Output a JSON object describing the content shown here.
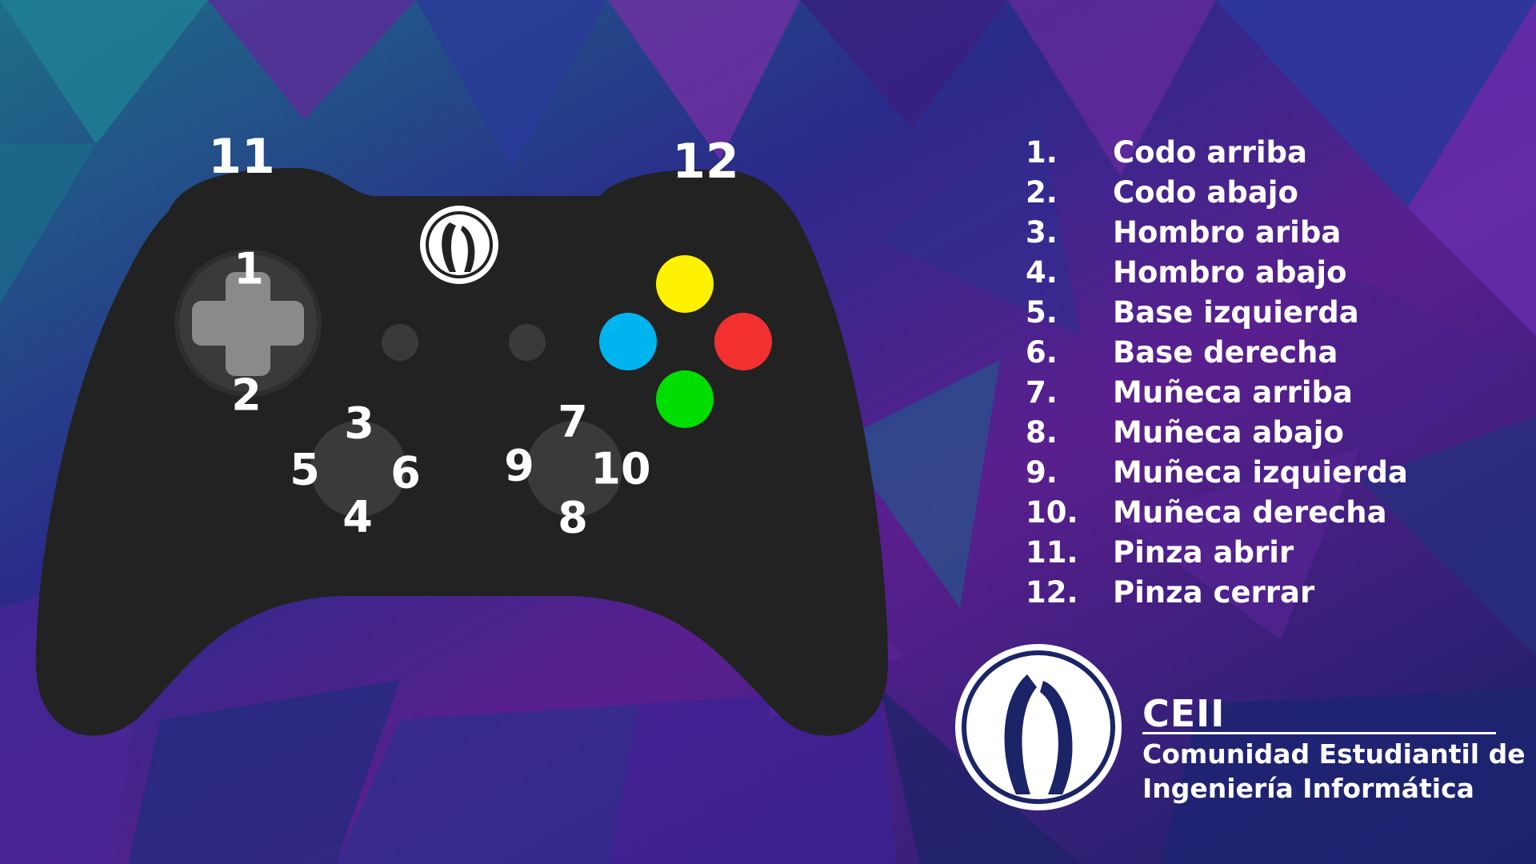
{
  "colors": {
    "controller_body": "#222222",
    "btn_top": "#fff200",
    "btn_left": "#00b4f0",
    "btn_right": "#f23030",
    "btn_bottom": "#00dd00"
  },
  "labels": {
    "n1": "1",
    "n2": "2",
    "n3": "3",
    "n4": "4",
    "n5": "5",
    "n6": "6",
    "n7": "7",
    "n8": "8",
    "n9": "9",
    "n10": "10",
    "n11": "11",
    "n12": "12"
  },
  "legend": [
    {
      "num": "1.",
      "label": "Codo arriba"
    },
    {
      "num": "2.",
      "label": "Codo abajo"
    },
    {
      "num": "3.",
      "label": "Hombro ariba"
    },
    {
      "num": "4.",
      "label": "Hombro abajo"
    },
    {
      "num": "5.",
      "label": "Base izquierda"
    },
    {
      "num": "6.",
      "label": "Base derecha"
    },
    {
      "num": "7.",
      "label": "Muñeca arriba"
    },
    {
      "num": "8.",
      "label": "Muñeca abajo"
    },
    {
      "num": "9.",
      "label": "Muñeca izquierda"
    },
    {
      "num": "10.",
      "label": "Muñeca derecha"
    },
    {
      "num": "11.",
      "label": "Pinza abrir"
    },
    {
      "num": "12.",
      "label": "Pinza cerrar"
    }
  ],
  "brand": {
    "title": "CEII",
    "line1": "Comunidad Estudiantil de",
    "line2": "Ingeniería Informática"
  }
}
